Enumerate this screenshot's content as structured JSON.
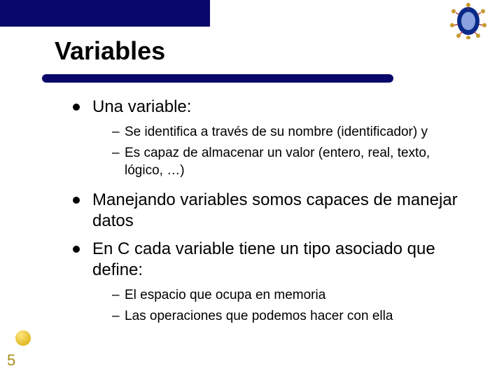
{
  "colors": {
    "accent": "#09086a",
    "pageNumber": "#a88c1a"
  },
  "slide": {
    "title": "Variables",
    "pageNumber": "5",
    "bullets": {
      "b1": {
        "text": "Una variable:",
        "sub": {
          "s1": "Se identifica a través de su nombre (identificador) y",
          "s2": "Es capaz de almacenar un valor (entero, real, texto, lógico, …)"
        }
      },
      "b2": {
        "text": "Manejando variables somos capaces de manejar datos"
      },
      "b3": {
        "text": "En C cada variable tiene un tipo asociado que define:",
        "sub": {
          "s1": "El espacio que ocupa en memoria",
          "s2": "Las operaciones que podemos hacer con ella"
        }
      }
    }
  }
}
